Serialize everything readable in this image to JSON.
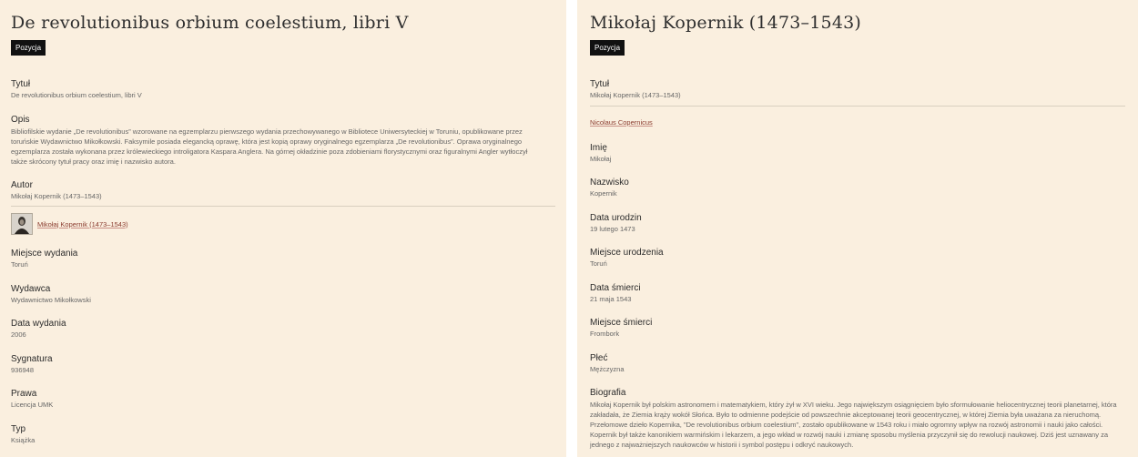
{
  "left": {
    "title": "De revolutionibus orbium coelestium, libri V",
    "badge": "Pozycja",
    "tytul_label": "Tytuł",
    "tytul_value": "De revolutionibus orbium coelestium, libri V",
    "opis_label": "Opis",
    "opis_value": "Bibliofilskie wydanie „De revolutionibus” wzorowane na egzemplarzu pierwszego wydania przechowywanego w Bibliotece Uniwersyteckiej w Toruniu, opublikowane przez toruńskie Wydawnictwo Mikołkowski. Faksymile posiada elegancką oprawę, która jest kopią oprawy oryginalnego egzemplarza „De revolutionibus”. Oprawa oryginalnego egzemplarza została wykonana przez królewieckiego introligatora Kaspara Anglera. Na górnej okładzinie poza zdobieniami florystycznymi oraz figuralnymi Angler wytłoczył także skrócony tytuł pracy oraz imię i nazwisko autora.",
    "autor_label": "Autor",
    "autor_value": "Mikołaj Kopernik (1473–1543)",
    "autor_link": "Mikołaj Kopernik (1473–1543)",
    "miejsce_label": "Miejsce wydania",
    "miejsce_value": "Toruń",
    "wydawca_label": "Wydawca",
    "wydawca_value": "Wydawnictwo Mikołkowski",
    "data_label": "Data wydania",
    "data_value": "2006",
    "sygnatura_label": "Sygnatura",
    "sygnatura_value": "936948",
    "prawa_label": "Prawa",
    "prawa_value": "Licencja UMK",
    "typ_label": "Typ",
    "typ_value": "Książka"
  },
  "right": {
    "title": "Mikołaj Kopernik (1473–1543)",
    "badge": "Pozycja",
    "tytul_label": "Tytuł",
    "tytul_value": "Mikołaj Kopernik (1473–1543)",
    "tytul_link": "Nicolaus Copernicus",
    "imie_label": "Imię",
    "imie_value": "Mikołaj",
    "nazwisko_label": "Nazwisko",
    "nazwisko_value": "Kopernik",
    "urodzin_label": "Data urodzin",
    "urodzin_value": "19 lutego 1473",
    "miejsce_ur_label": "Miejsce urodzenia",
    "miejsce_ur_value": "Toruń",
    "smierci_label": "Data śmierci",
    "smierci_value": "21 maja 1543",
    "miejsce_sm_label": "Miejsce śmierci",
    "miejsce_sm_value": "Frombork",
    "plec_label": "Płeć",
    "plec_value": "Mężczyzna",
    "bio_label": "Biografia",
    "bio_value": "Mikołaj Kopernik był polskim astronomem i matematykiem, który żył w XVI wieku. Jego największym osiągnięciem było sformułowanie heliocentrycznej teorii planetarnej, która zakładała, że Ziemia krąży wokół Słońca. Było to odmienne podejście od powszechnie akceptowanej teorii geocentrycznej, w której Ziemia była uważana za nieruchomą. Przełomowe dzieło Kopernika, \"De revolutionibus orbium coelestium\", zostało opublikowane w 1543 roku i miało ogromny wpływ na rozwój astronomii i nauki jako całości. Kopernik był także kanonikiem warmińskim i lekarzem, a jego wkład w rozwój nauki i zmianę sposobu myślenia przyczynił się do rewolucji naukowej. Dziś jest uznawany za jednego z najważniejszych naukowców w historii i symbol postępu i odkryć naukowych."
  }
}
